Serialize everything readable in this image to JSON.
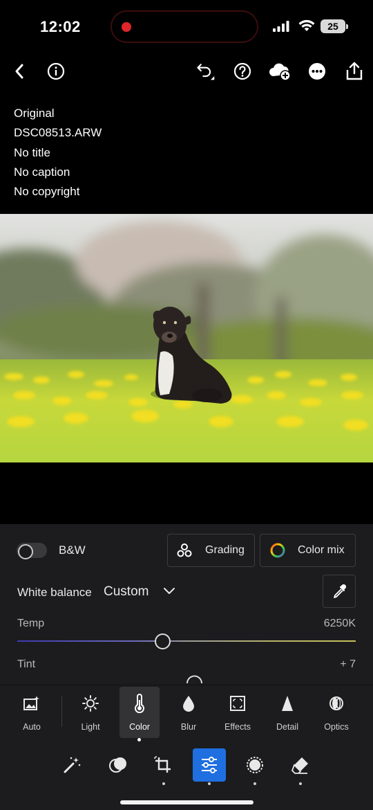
{
  "status_bar": {
    "time": "12:02",
    "battery": "25"
  },
  "info": {
    "lines": [
      "Original",
      "DSC08513.ARW",
      "No title",
      "No caption",
      "No copyright"
    ]
  },
  "color_panel": {
    "bw_label": "B&W",
    "bw_enabled": false,
    "grading_label": "Grading",
    "color_mix_label": "Color mix",
    "white_balance_label": "White balance",
    "white_balance_value": "Custom",
    "temp_label": "Temp",
    "temp_value": "6250K",
    "temp_level": 0.43,
    "tint_label": "Tint",
    "tint_value": "+ 7"
  },
  "tool_tabs": [
    {
      "label": "Auto",
      "icon": "auto-wand-photo-icon"
    },
    {
      "label": "Light",
      "icon": "sun-icon"
    },
    {
      "label": "Color",
      "icon": "thermometer-icon",
      "active": true
    },
    {
      "label": "Blur",
      "icon": "drop-icon"
    },
    {
      "label": "Effects",
      "icon": "effects-square-icon"
    },
    {
      "label": "Detail",
      "icon": "triangle-icon"
    },
    {
      "label": "Optics",
      "icon": "lens-icon"
    }
  ],
  "bottom_tools": [
    {
      "icon": "magic-wand-icon"
    },
    {
      "icon": "presets-icon"
    },
    {
      "icon": "crop-icon"
    },
    {
      "icon": "edit-sliders-icon",
      "active": true
    },
    {
      "icon": "masking-icon"
    },
    {
      "icon": "heal-eraser-icon"
    }
  ],
  "colors": {
    "accent": "#1f6fe0",
    "panel": "#1c1c1e",
    "record": "#e0262a"
  }
}
